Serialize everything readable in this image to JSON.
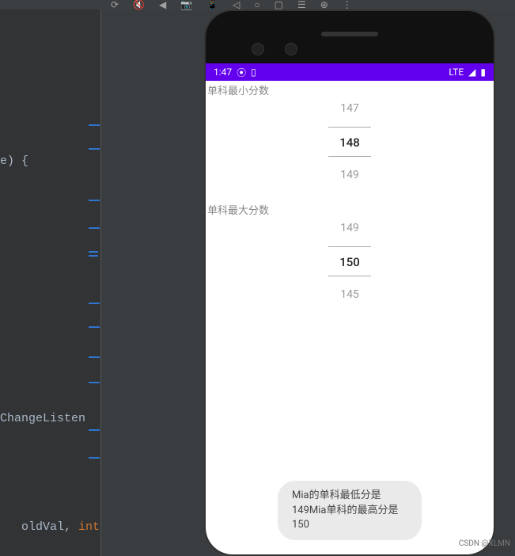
{
  "ide": {
    "code_frag1": "e) {",
    "code_frag2": "ChangeListen",
    "code_frag3_a": " oldVal",
    "code_frag3_b": ", ",
    "code_frag3_c": "int"
  },
  "phone": {
    "status": {
      "time": "1:47",
      "network": "LTE"
    },
    "labels": {
      "min_score": "单科最小分数",
      "max_score": "单科最大分数"
    },
    "picker_min": {
      "prev": "147",
      "selected": "148",
      "next": "149"
    },
    "picker_max": {
      "prev": "149",
      "selected": "150",
      "next": "145"
    },
    "toast": "Mia的单科最低分是149Mia单科的最高分是150"
  },
  "watermark": "CSDN @XLMN"
}
